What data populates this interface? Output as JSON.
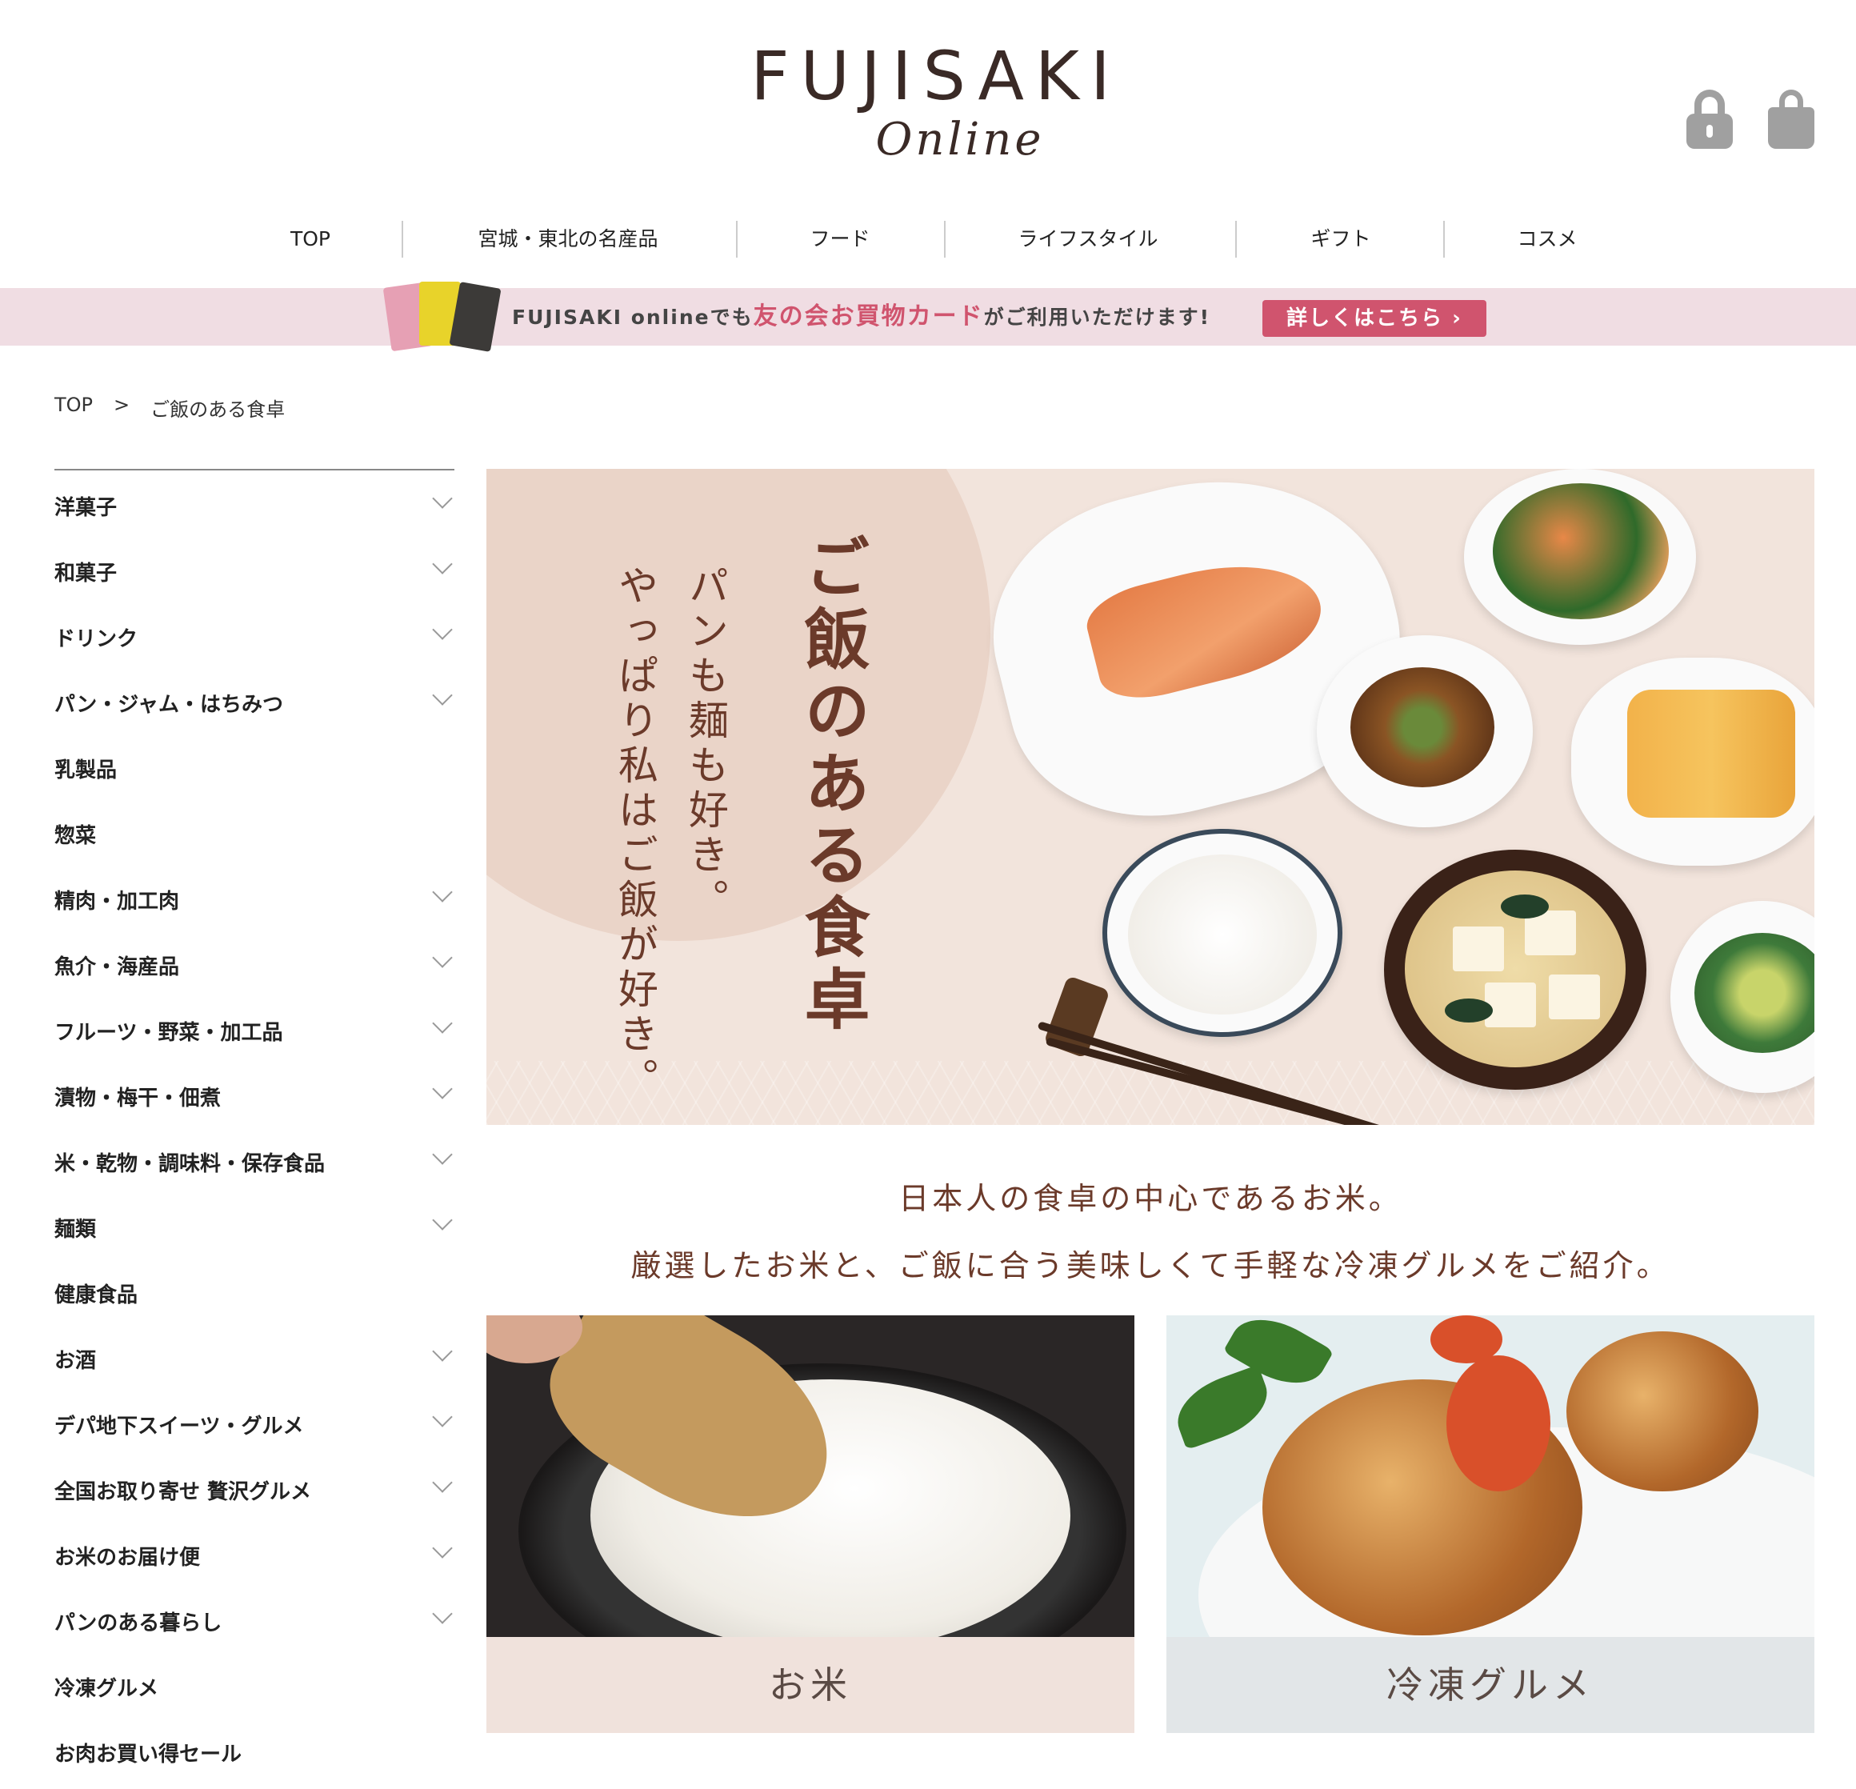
{
  "header": {
    "logo_main": "FUJISAKI",
    "logo_sub": "Online"
  },
  "nav": {
    "items": [
      "TOP",
      "宮城・東北の名産品",
      "フード",
      "ライフスタイル",
      "ギフト",
      "コスメ"
    ]
  },
  "banner": {
    "text_prefix": "FUJISAKI onlineでも",
    "text_accent": "友の会お買物カード",
    "text_suffix": "がご利用いただけます!",
    "button_label": "詳しくはこちら ›"
  },
  "breadcrumb": {
    "home": "TOP",
    "separator": ">",
    "current": "ご飯のある食卓"
  },
  "sidebar": {
    "items": [
      {
        "label": "洋菓子",
        "expandable": true
      },
      {
        "label": "和菓子",
        "expandable": true
      },
      {
        "label": "ドリンク",
        "expandable": true
      },
      {
        "label": "パン・ジャム・はちみつ",
        "expandable": true
      },
      {
        "label": "乳製品",
        "expandable": false
      },
      {
        "label": "惣菜",
        "expandable": false
      },
      {
        "label": "精肉・加工肉",
        "expandable": true
      },
      {
        "label": "魚介・海産品",
        "expandable": true
      },
      {
        "label": "フルーツ・野菜・加工品",
        "expandable": true
      },
      {
        "label": "漬物・梅干・佃煮",
        "expandable": true
      },
      {
        "label": "米・乾物・調味料・保存食品",
        "expandable": true
      },
      {
        "label": "麺類",
        "expandable": true
      },
      {
        "label": "健康食品",
        "expandable": false
      },
      {
        "label": "お酒",
        "expandable": true
      },
      {
        "label": "デパ地下スイーツ・グルメ",
        "expandable": true
      },
      {
        "label": "全国お取り寄せ 贅沢グルメ",
        "expandable": true
      },
      {
        "label": "お米のお届け便",
        "expandable": true
      },
      {
        "label": "パンのある暮らし",
        "expandable": true
      },
      {
        "label": "冷凍グルメ",
        "expandable": false
      },
      {
        "label": "お肉お買い得セール",
        "expandable": false
      }
    ]
  },
  "hero": {
    "title": "ご飯のある食卓",
    "sub1": "パンも麺も好き。",
    "sub2": "やっぱり私はご飯が好き。"
  },
  "intro": {
    "line1": "日本人の食卓の中心であるお米。",
    "line2": "厳選したお米と、ご飯に合う美味しくて手軽な冷凍グルメをご紹介。"
  },
  "categories": {
    "rice": "お米",
    "frozen": "冷凍グルメ"
  },
  "colors": {
    "accent_pink": "#d0546e",
    "banner_bg": "#f0dde3",
    "hero_text": "#6b3a2a"
  }
}
